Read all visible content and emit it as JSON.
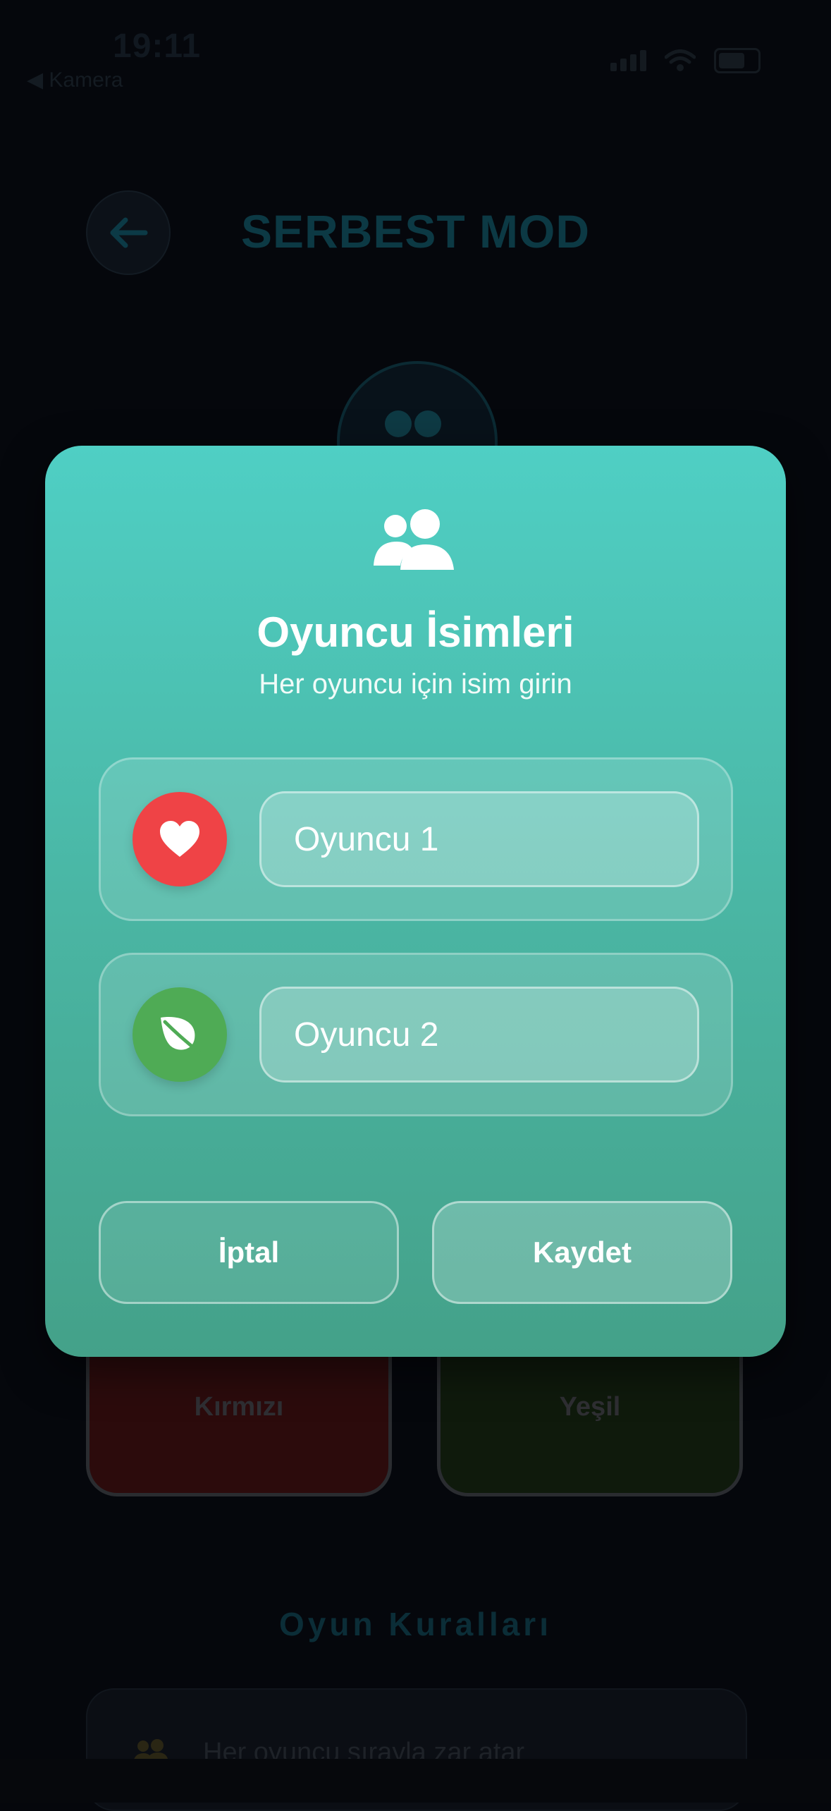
{
  "status_bar": {
    "time": "19:11",
    "back_app": "◀ Kamera"
  },
  "header": {
    "title": "SERBEST MOD"
  },
  "color_cards": [
    {
      "label": "Kırmızı",
      "color": "#ef4346"
    },
    {
      "label": "Yeşil",
      "color": "#4fab55"
    }
  ],
  "rules": {
    "title": "Oyun Kuralları",
    "items": [
      "Her oyuncu sırayla zar atar"
    ]
  },
  "modal": {
    "icon": "users-icon",
    "title": "Oyuncu İsimleri",
    "subtitle": "Her oyuncu için isim girin",
    "players": [
      {
        "icon": "heart-icon",
        "color": "#ef4346",
        "value": "Oyuncu 1"
      },
      {
        "icon": "leaf-icon",
        "color": "#4fab55",
        "value": "Oyuncu 2"
      }
    ],
    "cancel_label": "İptal",
    "save_label": "Kaydet"
  },
  "colors": {
    "modal_top": "#4fcfc4",
    "modal_bottom": "#44a189",
    "background": "#05070c"
  }
}
